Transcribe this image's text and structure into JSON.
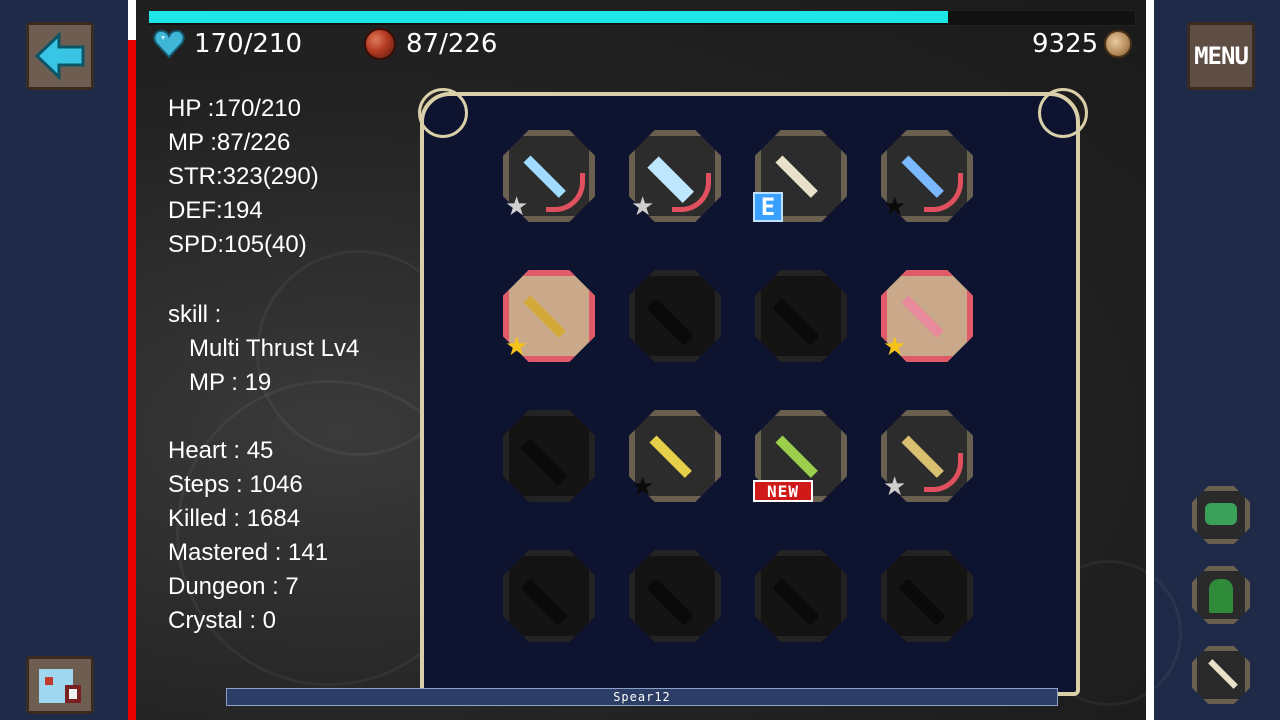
{
  "top": {
    "hp_display": "170/210",
    "mp_display": "87/226",
    "gold": "9325",
    "hp_fraction": 0.81
  },
  "buttons": {
    "menu_label": "MENU"
  },
  "stats": {
    "hp": "HP :170/210",
    "mp": "MP :87/226",
    "str": "STR:323(290)",
    "def": "DEF:194",
    "spd": "SPD:105(40)",
    "skill_header": "skill :",
    "skill_name": "Multi Thrust Lv4",
    "skill_mp": "MP : 19",
    "heart": "Heart : 45",
    "steps": "Steps : 1046",
    "killed": "Killed : 1684",
    "mastered": "Mastered : 141",
    "dungeon": "Dungeon : 7",
    "crystal": "Crystal : 0"
  },
  "inventory": {
    "selected_name": "Spear12",
    "badges": {
      "equipped": "E",
      "new": "NEW"
    }
  },
  "colors": {
    "hp_bar": "#1fe6e6",
    "accent_red": "#e60000",
    "frame": "#d9cfa8",
    "star_gold": "#f5c21a",
    "star_silver": "#cfcfcf"
  },
  "icons": {
    "back": "back-arrow-icon",
    "hp": "heart-gem-icon",
    "mp": "mana-orb-icon",
    "gold": "coin-icon",
    "menu": "menu-icon"
  }
}
